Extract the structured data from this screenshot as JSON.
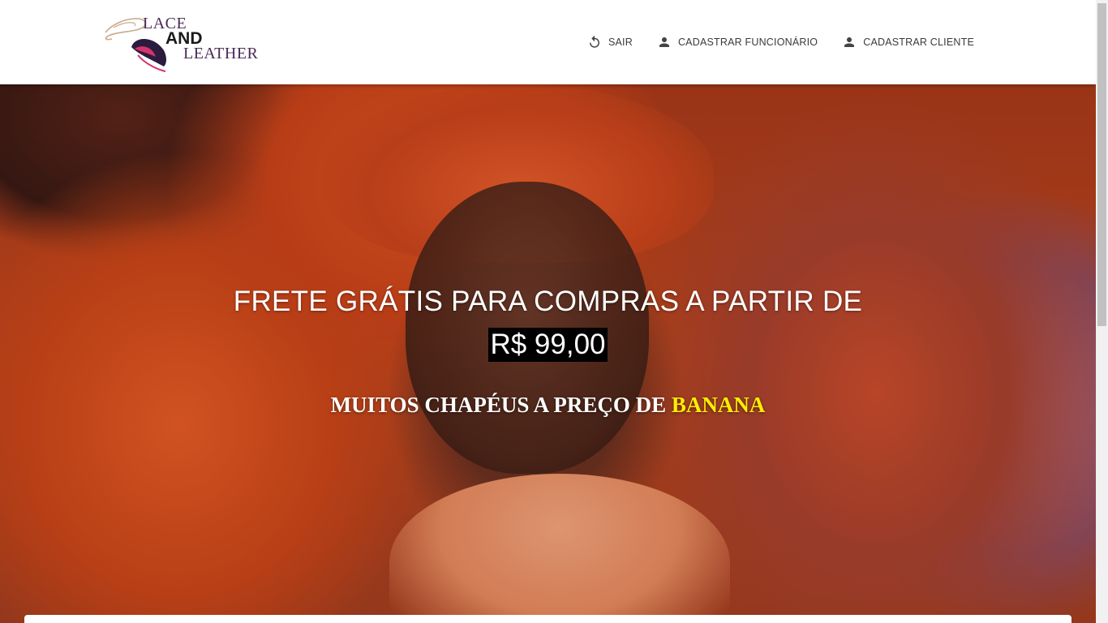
{
  "brand": {
    "line1": "LACE",
    "line2": "AND",
    "line3": "LEATHER"
  },
  "nav": {
    "items": [
      {
        "label": "SAIR",
        "icon": "logout-icon"
      },
      {
        "label": "CADASTRAR FUNCIONÁRIO",
        "icon": "person-icon"
      },
      {
        "label": "CADASTRAR CLIENTE",
        "icon": "person-icon"
      }
    ]
  },
  "hero": {
    "headline": "FRETE GRÁTIS PARA COMPRAS A PARTIR DE",
    "price": "R$ 99,00",
    "tagline_prefix": "MUITOS CHAPÉUS A PREÇO DE",
    "tagline_highlight": "BANANA"
  },
  "colors": {
    "highlight": "#ffee00",
    "price_bg": "#000000",
    "nav_text": "#3a3a3a",
    "brand_accent": "#d6336c"
  }
}
